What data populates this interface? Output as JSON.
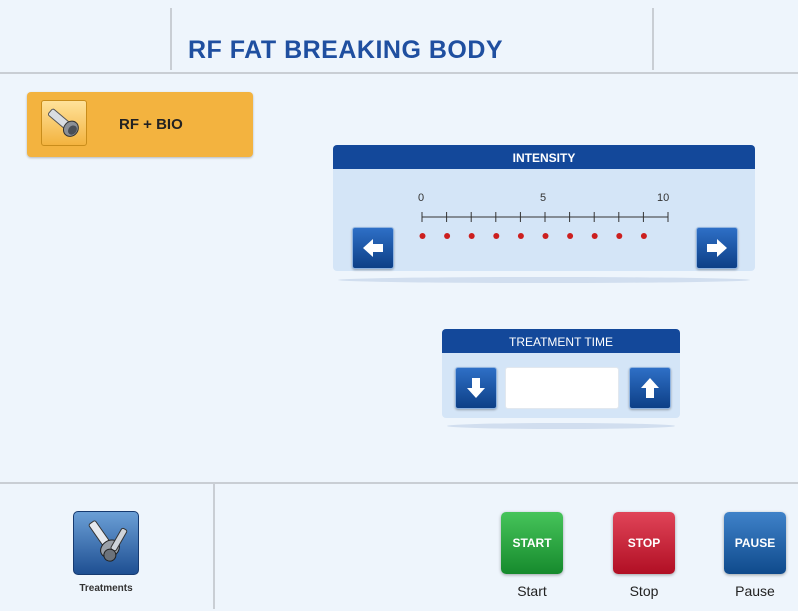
{
  "header": {
    "title": "RF FAT BREAKING BODY"
  },
  "mode": {
    "label": "RF + BIO",
    "icon": "rf-handpiece-icon"
  },
  "intensity": {
    "title": "INTENSITY",
    "scale_min_label": "0",
    "scale_mid_label": "5",
    "scale_max_label": "10",
    "level": 0,
    "max": 10,
    "dot_color": "#cc1f1f",
    "decrease_icon": "arrow-left-icon",
    "increase_icon": "arrow-right-icon"
  },
  "treatment_time": {
    "title": "TREATMENT TIME",
    "value": "",
    "decrease_icon": "arrow-down-icon",
    "increase_icon": "arrow-up-icon"
  },
  "footer": {
    "treatments_label": "Treatments",
    "treatments_icon": "treatment-tools-icon",
    "start_button": "START",
    "start_label": "Start",
    "stop_button": "STOP",
    "stop_label": "Stop",
    "pause_button": "PAUSE",
    "pause_label": "Pause"
  },
  "colors": {
    "accent": "#13489a",
    "title": "#1f4fa0",
    "mode_button": "#f3b33f",
    "start": "#21a03b",
    "stop": "#c8152a",
    "pause": "#17589e"
  }
}
